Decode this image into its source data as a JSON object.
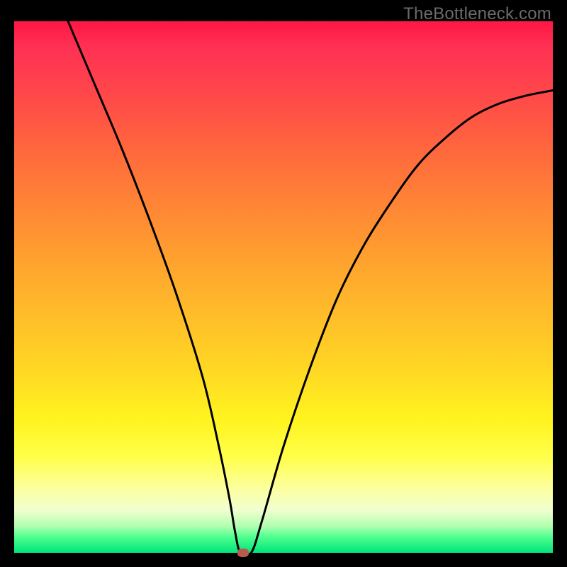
{
  "watermark": "TheBottleneck.com",
  "chart_data": {
    "type": "line",
    "title": "",
    "xlabel": "",
    "ylabel": "",
    "xlim": [
      0,
      100
    ],
    "ylim": [
      0,
      100
    ],
    "x": [
      10,
      15,
      20,
      25,
      30,
      35,
      38,
      40,
      41,
      42,
      44,
      46,
      50,
      55,
      60,
      65,
      70,
      75,
      80,
      85,
      90,
      95,
      100
    ],
    "values": [
      100,
      88,
      76,
      63,
      49,
      33,
      20,
      10,
      4,
      0,
      0,
      6,
      20,
      35,
      48,
      58,
      66,
      73,
      78,
      82,
      84.5,
      86,
      87
    ],
    "marker": {
      "x": 42.5,
      "y": 0
    },
    "gradient_stops": [
      {
        "pct": 0,
        "color": "#ff1744"
      },
      {
        "pct": 25,
        "color": "#ff6a3c"
      },
      {
        "pct": 55,
        "color": "#ffbc2a"
      },
      {
        "pct": 80,
        "color": "#ffff4a"
      },
      {
        "pct": 100,
        "color": "#00e47a"
      }
    ]
  }
}
